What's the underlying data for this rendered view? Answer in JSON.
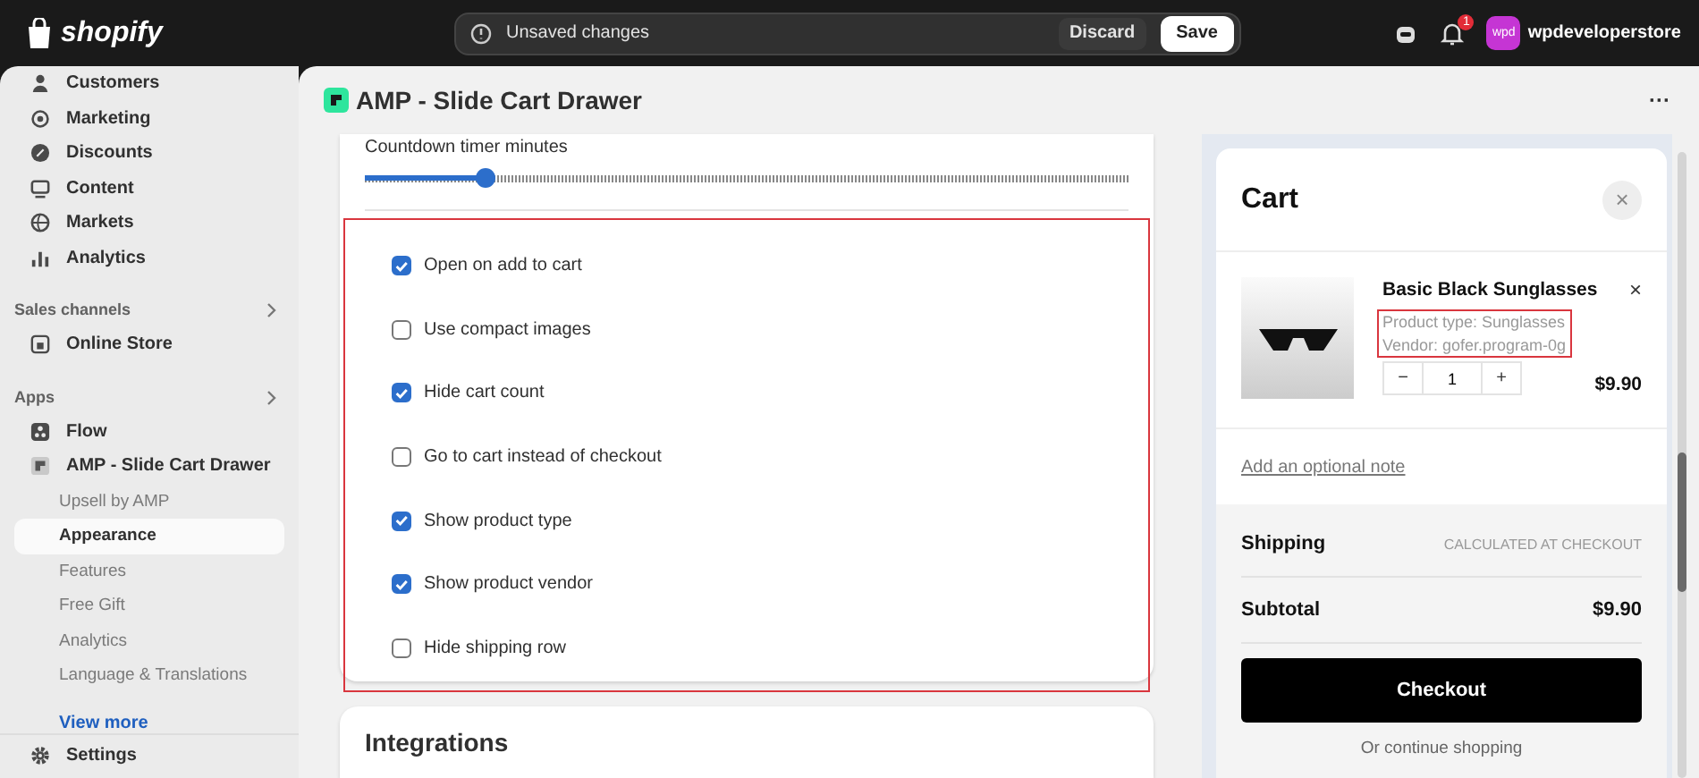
{
  "topbar": {
    "logo": "shopify",
    "notice": "Unsaved changes",
    "discard": "Discard",
    "save": "Save",
    "notification_count": "1",
    "avatar": "wpd",
    "store": "wpdeveloperstore"
  },
  "sidebar": {
    "sections": [
      {
        "items": [
          {
            "label": "Customers",
            "kind": "person",
            "selected": false
          },
          {
            "label": "Marketing",
            "kind": "target",
            "selected": false
          },
          {
            "label": "Discounts",
            "kind": "badge",
            "selected": false
          },
          {
            "label": "Content",
            "kind": "monitor",
            "selected": false
          },
          {
            "label": "Markets",
            "kind": "globe",
            "selected": false
          },
          {
            "label": "Analytics",
            "kind": "bars",
            "selected": false
          }
        ]
      },
      {
        "heading": "Sales channels",
        "items": [
          {
            "label": "Online Store",
            "kind": "store",
            "selected": false
          }
        ]
      },
      {
        "heading": "Apps",
        "items": [
          {
            "label": "Flow",
            "kind": "flow",
            "selected": false
          },
          {
            "label": "AMP - Slide Cart Drawer",
            "kind": "app",
            "selected": false,
            "children": [
              {
                "label": "Upsell by AMP",
                "selected": false
              },
              {
                "label": "Appearance",
                "selected": true
              },
              {
                "label": "Features",
                "selected": false
              },
              {
                "label": "Free Gift",
                "selected": false
              },
              {
                "label": "Analytics",
                "selected": false
              },
              {
                "label": "Language & Translations",
                "selected": false
              }
            ]
          }
        ]
      }
    ],
    "view_more": "View more",
    "settings": "Settings"
  },
  "page": {
    "title": "AMP - Slide Cart Drawer",
    "more": "···"
  },
  "settings": {
    "slider": {
      "label": "Countdown timer minutes",
      "level": 0.16
    },
    "checkboxes": [
      {
        "label": "Open on add to cart",
        "checked": true
      },
      {
        "label": "Use compact images",
        "checked": false
      },
      {
        "label": "Hide cart count",
        "checked": true
      },
      {
        "label": "Go to cart instead of checkout",
        "checked": false
      },
      {
        "label": "Show product type",
        "checked": true
      },
      {
        "label": "Show product vendor",
        "checked": true
      },
      {
        "label": "Hide shipping row",
        "checked": false
      }
    ],
    "next_section": "Integrations"
  },
  "cart": {
    "title": "Cart",
    "close": "×",
    "product": {
      "name": "Basic Black Sunglasses",
      "remove": "×",
      "type": "Product type: Sunglasses",
      "vendor": "Vendor: gofer.program-0g",
      "minus": "−",
      "quantity": "1",
      "plus": "+",
      "price": "$9.90"
    },
    "note_link": "Add an optional note",
    "shipping_label": "Shipping",
    "shipping_value": "CALCULATED AT CHECKOUT",
    "subtotal_label": "Subtotal",
    "subtotal_value": "$9.90",
    "checkout": "Checkout",
    "continue": "Or continue shopping"
  }
}
